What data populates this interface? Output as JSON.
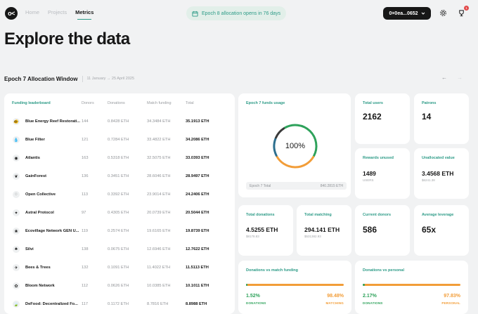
{
  "header": {
    "logo": "o<",
    "nav": [
      "Home",
      "Projects",
      "Metrics"
    ],
    "epoch_notice": "Epoch 8 allocation opens in 76 days",
    "wallet": "0×0ea...0652",
    "notifications": "1"
  },
  "page_title": "Explore the data",
  "window": {
    "title": "Epoch 7 Allocation Window",
    "dates": "11 January → 25 April 2025",
    "prev_icon": "arrow-left-icon",
    "next_icon": "arrow-right-icon"
  },
  "leaderboard": {
    "headers": [
      "Funding leaderboard",
      "Donors",
      "Donations",
      "Match funding",
      "Total"
    ],
    "rows": [
      {
        "name": "Blue Energy Reef Restorati...",
        "donors": "144",
        "donations": "0.8428 ETH",
        "match": "34.3484 ETH",
        "total": "35.1913 ETH",
        "icon": "🐠"
      },
      {
        "name": "Blue Filter",
        "donors": "121",
        "donations": "0.7284 ETH",
        "match": "33.4822 ETH",
        "total": "34.2086 ETH",
        "icon": "💧"
      },
      {
        "name": "Atlantis",
        "donors": "163",
        "donations": "0.5318 ETH",
        "match": "32.5075 ETH",
        "total": "33.0393 ETH",
        "icon": "◉"
      },
      {
        "name": "GainForest",
        "donors": "136",
        "donations": "0.3451 ETH",
        "match": "28.6046 ETH",
        "total": "28.9497 ETH",
        "icon": "❦"
      },
      {
        "name": "Open Collective",
        "donors": "113",
        "donations": "0.3392 ETH",
        "match": "23.9014 ETH",
        "total": "24.2406 ETH",
        "icon": "◌"
      },
      {
        "name": "Astral Protocol",
        "donors": "97",
        "donations": "0.4305 ETH",
        "match": "20.0739 ETH",
        "total": "20.5044 ETH",
        "icon": "✦"
      },
      {
        "name": "Ecovillage Network GEN U...",
        "donors": "119",
        "donations": "0.2574 ETH",
        "match": "19.6165 ETH",
        "total": "19.8739 ETH",
        "icon": "❀"
      },
      {
        "name": "Silvi",
        "donors": "138",
        "donations": "0.0675 ETH",
        "match": "12.6946 ETH",
        "total": "12.7622 ETH",
        "icon": "♣"
      },
      {
        "name": "Bees & Trees",
        "donors": "132",
        "donations": "0.1091 ETH",
        "match": "11.4022 ETH",
        "total": "11.5113 ETH",
        "icon": "✈"
      },
      {
        "name": "Bloom Network",
        "donors": "112",
        "donations": "0.0626 ETH",
        "match": "10.0385 ETH",
        "total": "10.1011 ETH",
        "icon": "✿"
      },
      {
        "name": "DeFood: Decentralized Fo...",
        "donors": "117",
        "donations": "0.1172 ETH",
        "match": "8.7816 ETH",
        "total": "8.8988 ETH",
        "icon": "🍃"
      }
    ]
  },
  "funds_usage": {
    "label": "Epoch 7 funds usage",
    "percent": "100%",
    "footer_label": "Epoch 7 Total",
    "footer_value": "840.2815 ETH",
    "segments": [
      {
        "share": 0.42,
        "color": "#2ea25b"
      },
      {
        "share": 0.34,
        "color": "#f29d38"
      },
      {
        "share": 0.14,
        "color": "#2d6f8f"
      },
      {
        "share": 0.1,
        "color": "#3a3a3a"
      }
    ]
  },
  "total_users": {
    "label": "Total users",
    "value": "2162"
  },
  "patrons": {
    "label": "Patrons",
    "value": "14"
  },
  "rewards_unused": {
    "label": "Rewards unused",
    "value": "1489",
    "sub": "USERS"
  },
  "unallocated": {
    "label": "Unallocated value",
    "value": "3.4568 ETH",
    "sub": "$6241.38"
  },
  "total_donations": {
    "label": "Total donations",
    "value": "4.5255 ETH",
    "sub": "$8178.83"
  },
  "total_matching": {
    "label": "Total matching",
    "value": "294.141 ETH",
    "sub": "$531382.93"
  },
  "current_donors": {
    "label": "Current donors",
    "value": "586"
  },
  "avg_leverage": {
    "label": "Average leverage",
    "value": "65x"
  },
  "donations_vs_match": {
    "label": "Donations vs match funding",
    "left_pct": "1.52%",
    "left_cap": "DONATIONS",
    "right_pct": "98.48%",
    "right_cap": "MATCHING",
    "left_fraction": 0.0152
  },
  "donations_vs_personal": {
    "label": "Donations vs personal",
    "left_pct": "2.17%",
    "left_cap": "DONATIONS",
    "right_pct": "97.83%",
    "right_cap": "PERSONAL",
    "left_fraction": 0.0217
  },
  "colors": {
    "accent": "#2d9b87",
    "orange": "#f29d38",
    "dark": "#171717"
  }
}
